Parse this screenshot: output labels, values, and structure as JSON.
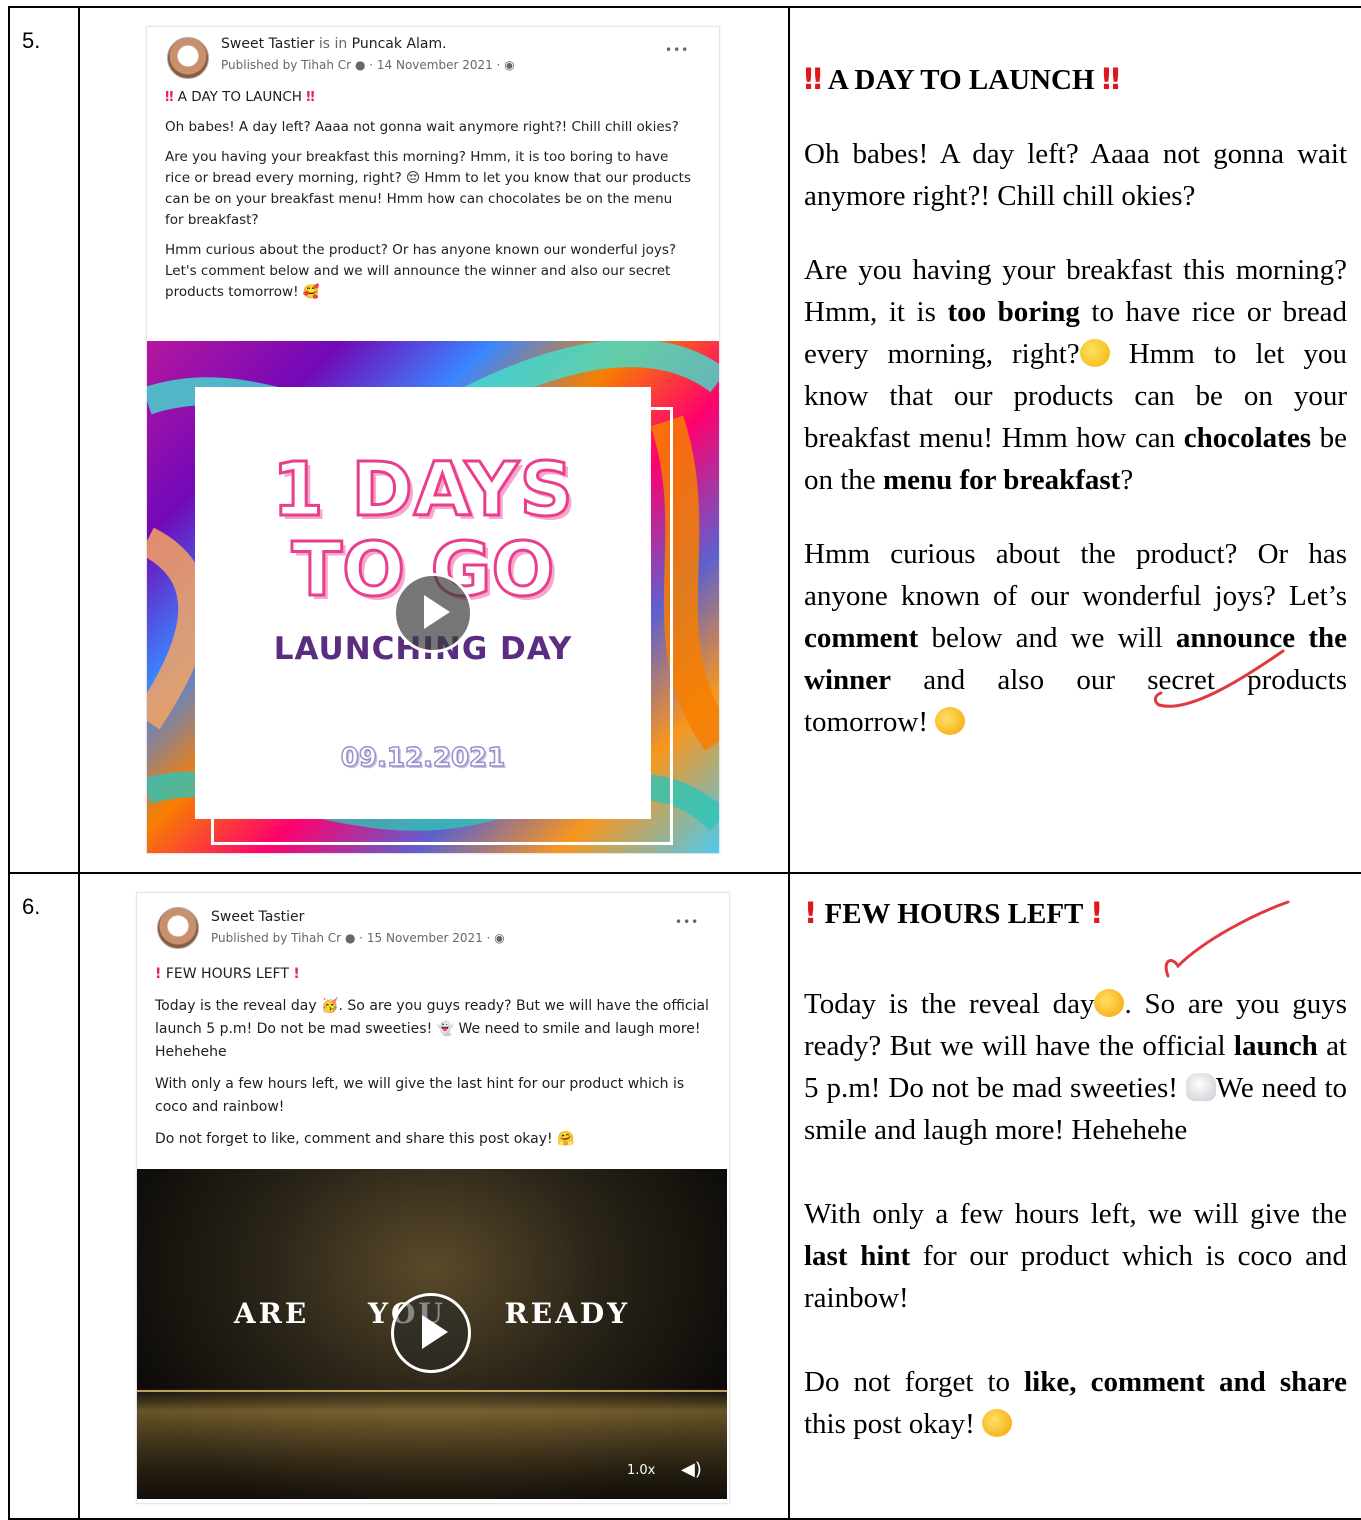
{
  "rows": [
    {
      "number": "5.",
      "post": {
        "page_name": "Sweet Tastier",
        "is_in": "is in",
        "location": "Puncak Alam.",
        "published_by": "Published by Tihah Cr",
        "date": "· 14 November 2021 ·",
        "more": "•••",
        "headline": "A DAY TO LAUNCH",
        "paragraphs": [
          "Oh babes! A day left? Aaaa not gonna wait anymore right?! Chill chill okies?",
          "Are you having your breakfast this morning? Hmm, it is too boring to have rice or bread every morning, right? 😔 Hmm to let you know that our products can be on your breakfast menu! Hmm how can chocolates be on the menu for breakfast?",
          "Hmm curious about the product? Or has anyone known our wonderful joys? Let's comment below and we will announce the winner and also our secret products tomorrow! 🥰"
        ],
        "media": {
          "line1": "1 DAYS",
          "line2": "TO GO",
          "line3": "LAUNCHING DAY",
          "date": "09.12.2021"
        }
      },
      "doc": {
        "headline": "A DAY TO LAUNCH",
        "bang": "‼",
        "p1": "Oh babes! A day left? Aaaa not gonna wait anymore right?! Chill chill okies?",
        "p2a": "Are you having your breakfast this morning? Hmm, it is ",
        "p2b": "too boring",
        "p2c": " to have rice or bread every morning, right?",
        "p2d": " Hmm to let you know that our products can be on your breakfast menu! Hmm how can ",
        "p2e": "chocolates",
        "p2f": " be on the ",
        "p2g": "menu for breakfast",
        "p2h": "?",
        "p3a": "Hmm curious about the product? Or has anyone known of our wonderful joys? Let’s ",
        "p3b": "comment",
        "p3c": " below and we will ",
        "p3d": "announce the winner",
        "p3e": " and also our secret products tomorrow!"
      }
    },
    {
      "number": "6.",
      "post": {
        "page_name": "Sweet Tastier",
        "published_by": "Published by Tihah Cr",
        "date": "· 15 November 2021 ·",
        "more": "•••",
        "headline": "FEW HOURS LEFT",
        "paragraphs": [
          "Today is the reveal day 🥳. So are you guys ready? But we will have the official launch 5 p.m! Do not be mad sweeties! 👻 We need to smile and laugh more! Hehehehe",
          "With only a few hours left, we will give the last hint for our product which is coco and rainbow!",
          "Do not forget to like, comment and share this post okay! 🤗"
        ],
        "media": {
          "title": "ARE YOU READY",
          "speed": "1.0x"
        }
      },
      "doc": {
        "headline": "FEW HOURS LEFT",
        "bang": "!",
        "p1a": "Today is the reveal day",
        "p1b": ". So are you guys ready? But we will have the official ",
        "p1c": "launch",
        "p1d": " at 5 p.m! Do not be mad sweeties!",
        "p1e": "We need to smile and laugh more! Hehehehe",
        "p2a": "With only a few hours left, we will give the ",
        "p2b": "last hint",
        "p2c": " for our product which is coco and rainbow!",
        "p3a": "Do not forget to ",
        "p3b": "like, comment and share",
        "p3c": " this post okay!"
      }
    }
  ],
  "colors": {
    "bang": "#e0161b",
    "check_mark": "#e0383c",
    "launch_text": "#5a2d82",
    "pink_3d": "#e83e8c"
  }
}
